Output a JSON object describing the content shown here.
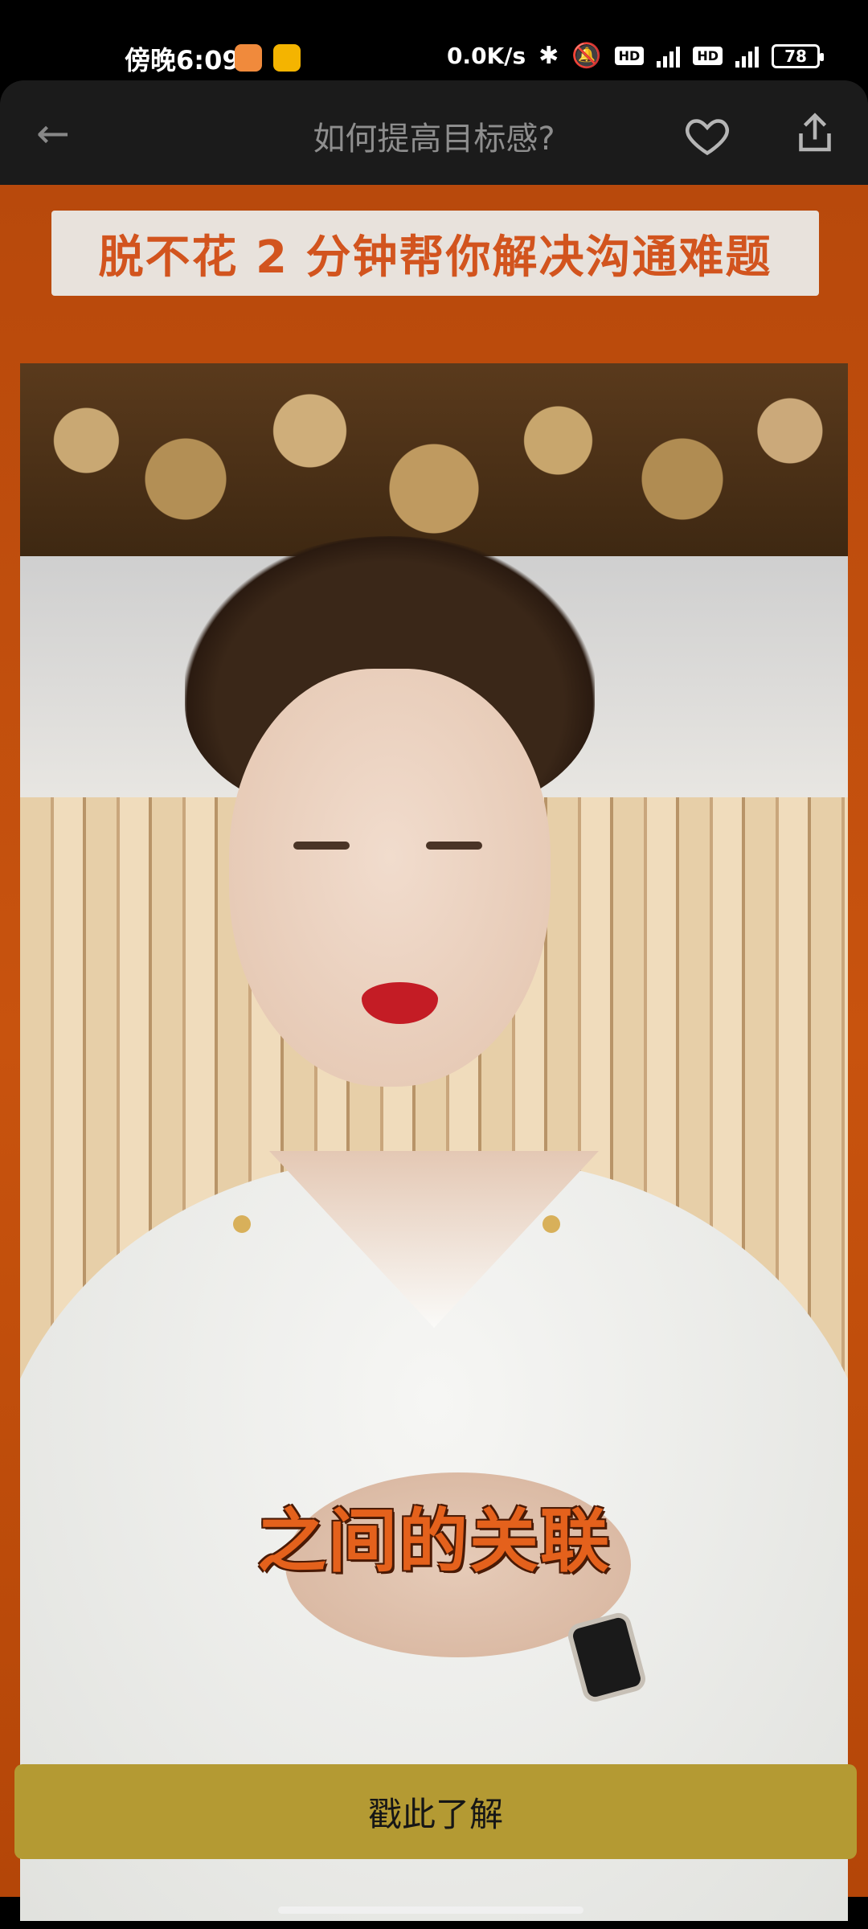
{
  "status_bar": {
    "time": "傍晚6:09",
    "net_speed": "0.0K/s",
    "hd_badge": "HD",
    "network": "4G",
    "battery": "78",
    "icons": [
      "bluetooth-icon",
      "mute-bell-icon",
      "signal-icon",
      "battery-icon"
    ]
  },
  "nav": {
    "title": "如何提高目标感?",
    "back_icon": "arrow-left-icon",
    "favorite_icon": "heart-icon",
    "share_icon": "share-icon"
  },
  "ad": {
    "banner_text": "脱不花 2 分钟帮你解决沟通难题",
    "video_subtitle": "之间的关联",
    "cta_label": "戳此了解"
  },
  "colors": {
    "ad_background": "#c0500c",
    "banner_text": "#d2541e",
    "cta_background": "#b49a33",
    "subtitle": "#e4611c"
  }
}
